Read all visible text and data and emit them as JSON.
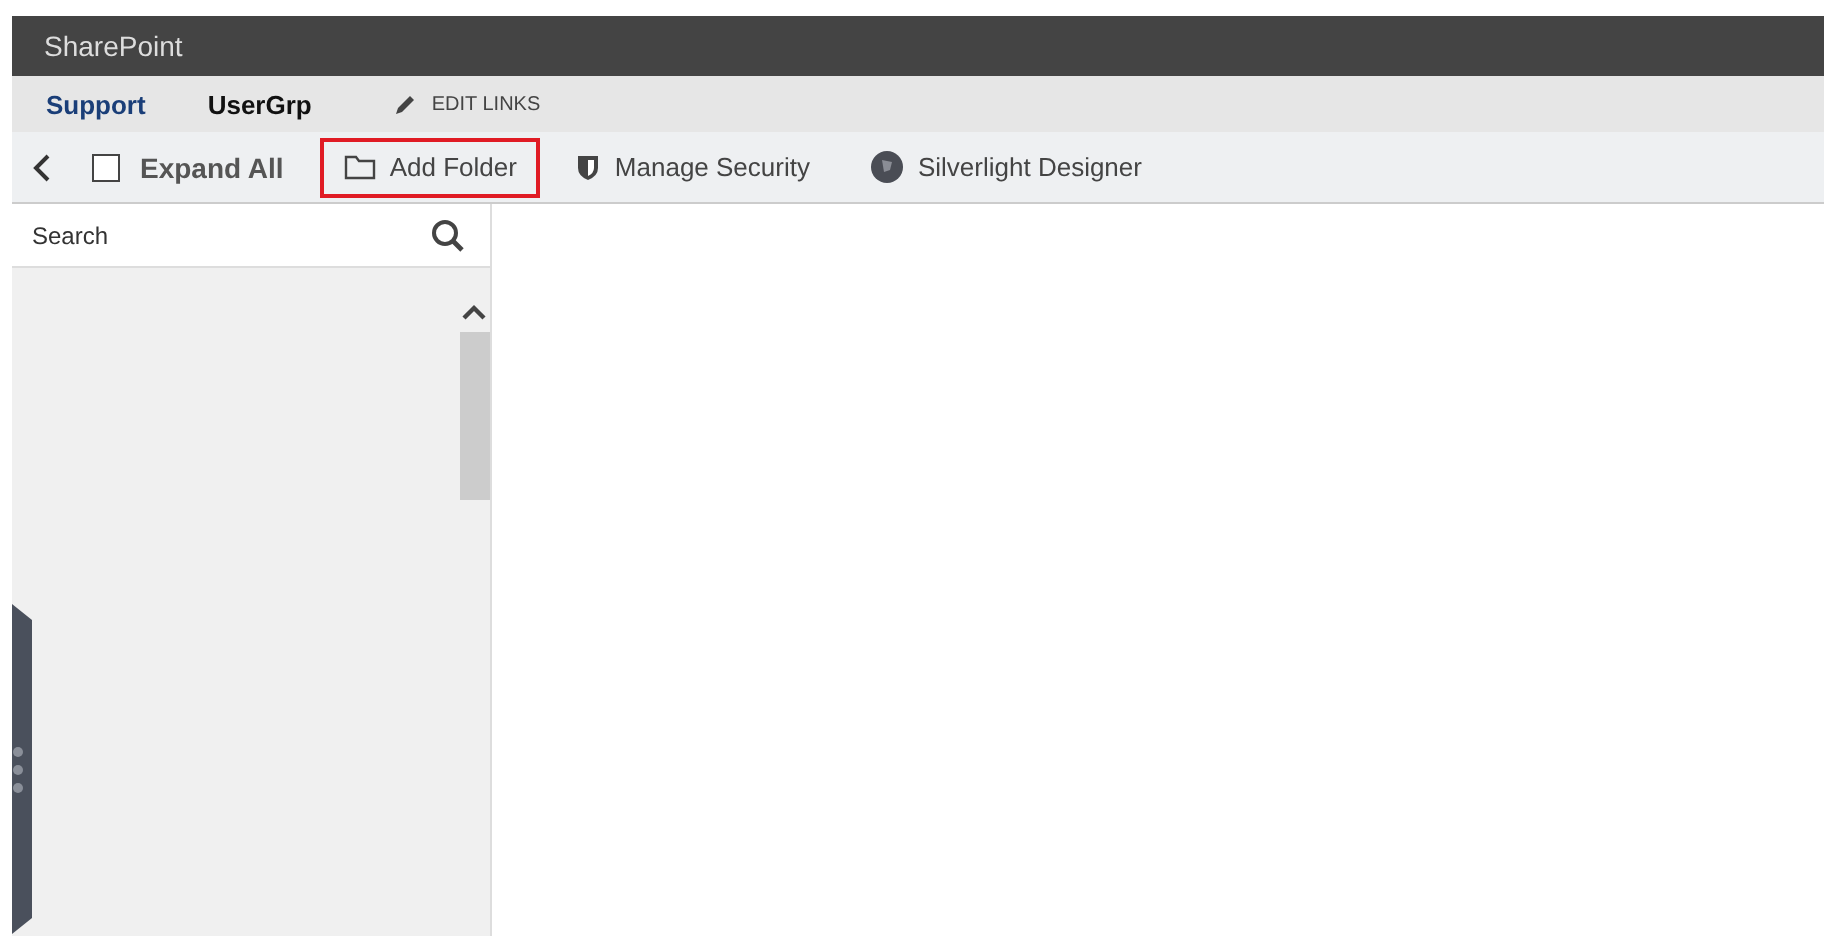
{
  "app_bar": {
    "title": "SharePoint"
  },
  "nav": {
    "links": [
      {
        "label": "Support",
        "selected": false
      },
      {
        "label": "UserGrp",
        "selected": true
      }
    ],
    "edit_links": "EDIT LINKS"
  },
  "toolbar": {
    "expand_all": {
      "label": "Expand All",
      "checked": false
    },
    "actions": [
      {
        "kind": "folder",
        "label": "Add Folder",
        "highlighted": true
      },
      {
        "kind": "shield",
        "label": "Manage Security",
        "highlighted": false
      },
      {
        "kind": "designer",
        "label": "Silverlight Designer",
        "highlighted": false
      }
    ]
  },
  "sidebar": {
    "search": {
      "placeholder": "Search"
    }
  }
}
